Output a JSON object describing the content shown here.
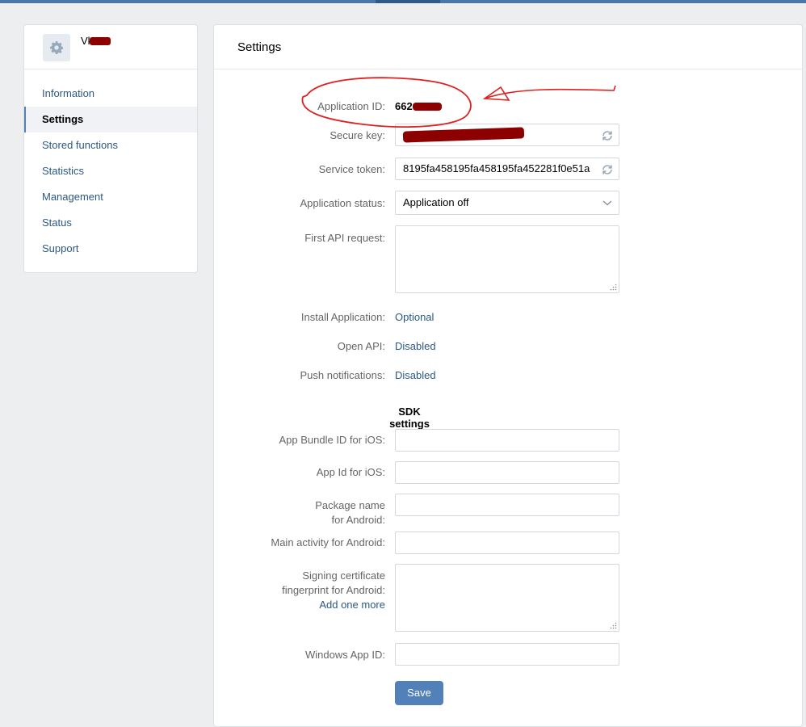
{
  "app": {
    "name": "Vk",
    "icon": "gear-icon"
  },
  "nav": {
    "items": [
      {
        "label": "Information",
        "active": false
      },
      {
        "label": "Settings",
        "active": true
      },
      {
        "label": "Stored functions",
        "active": false
      },
      {
        "label": "Statistics",
        "active": false
      },
      {
        "label": "Management",
        "active": false
      },
      {
        "label": "Status",
        "active": false
      },
      {
        "label": "Support",
        "active": false
      }
    ]
  },
  "main": {
    "title": "Settings",
    "application_id": {
      "label": "Application ID:",
      "value": "662"
    },
    "secure_key": {
      "label": "Secure key:",
      "value": ""
    },
    "service_token": {
      "label": "Service token:",
      "value": "8195fa458195fa458195fa452281f0e51a"
    },
    "application_status": {
      "label": "Application status:",
      "value": "Application off"
    },
    "first_api_request": {
      "label": "First API request:",
      "value": ""
    },
    "install_application": {
      "label": "Install Application:",
      "value": "Optional"
    },
    "open_api": {
      "label": "Open API:",
      "value": "Disabled"
    },
    "push_notifications": {
      "label": "Push notifications:",
      "value": "Disabled"
    },
    "sdk": {
      "title": "SDK settings",
      "bundle_ios": {
        "label": "App Bundle ID for iOS:",
        "value": ""
      },
      "app_id_ios": {
        "label": "App Id for iOS:",
        "value": ""
      },
      "package_android": {
        "label_line1": "Package name",
        "label_line2": "for Android:",
        "value": ""
      },
      "main_activity_android": {
        "label": "Main activity for Android:",
        "value": ""
      },
      "signing_cert": {
        "label_line1": "Signing certificate",
        "label_line2": "fingerprint for Android:",
        "add_link": "Add one more",
        "value": ""
      },
      "windows_app_id": {
        "label": "Windows App ID:",
        "value": ""
      }
    },
    "save_label": "Save"
  },
  "colors": {
    "accent": "#5181b8",
    "link": "#2a5885",
    "annotation": "#e02020",
    "redaction": "#8c0000"
  }
}
